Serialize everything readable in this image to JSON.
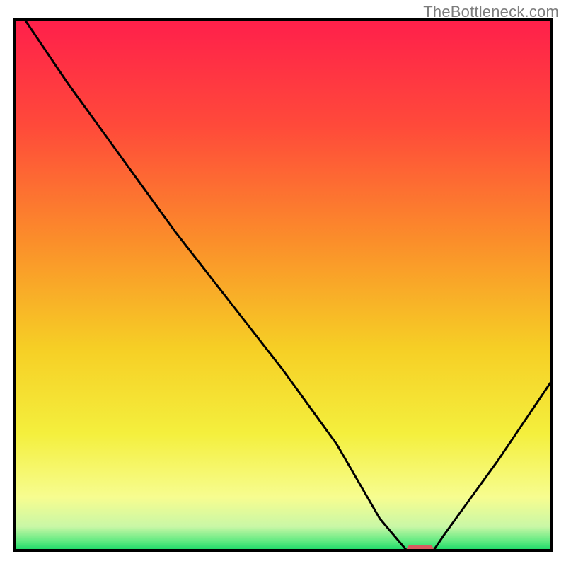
{
  "watermark": "TheBottleneck.com",
  "chart_data": {
    "type": "line",
    "title": "",
    "xlabel": "",
    "ylabel": "",
    "xlim": [
      0,
      100
    ],
    "ylim": [
      0,
      100
    ],
    "grid": false,
    "legend": false,
    "series": [
      {
        "name": "bottleneck-curve",
        "x": [
          2,
          10,
          20,
          25,
          30,
          40,
          50,
          60,
          68,
          73,
          78,
          80,
          90,
          100
        ],
        "y": [
          100,
          88,
          74,
          67,
          60,
          47,
          34,
          20,
          6,
          0,
          0,
          3,
          17,
          32
        ]
      }
    ],
    "marker": {
      "name": "optimal-range",
      "x_start": 73,
      "x_end": 78,
      "y": 0
    },
    "gradient_stops": [
      {
        "offset": 0.0,
        "color": "#ff1f4b"
      },
      {
        "offset": 0.2,
        "color": "#ff4a3a"
      },
      {
        "offset": 0.42,
        "color": "#fb8f2a"
      },
      {
        "offset": 0.62,
        "color": "#f6cf25"
      },
      {
        "offset": 0.78,
        "color": "#f4ef3d"
      },
      {
        "offset": 0.9,
        "color": "#f7fd90"
      },
      {
        "offset": 0.955,
        "color": "#c9f7a6"
      },
      {
        "offset": 0.985,
        "color": "#57e97e"
      },
      {
        "offset": 1.0,
        "color": "#18d867"
      }
    ],
    "frame_color": "#000000",
    "frame_width": 4,
    "curve_color": "#000000",
    "curve_width": 3,
    "marker_color": "#d85a60"
  }
}
